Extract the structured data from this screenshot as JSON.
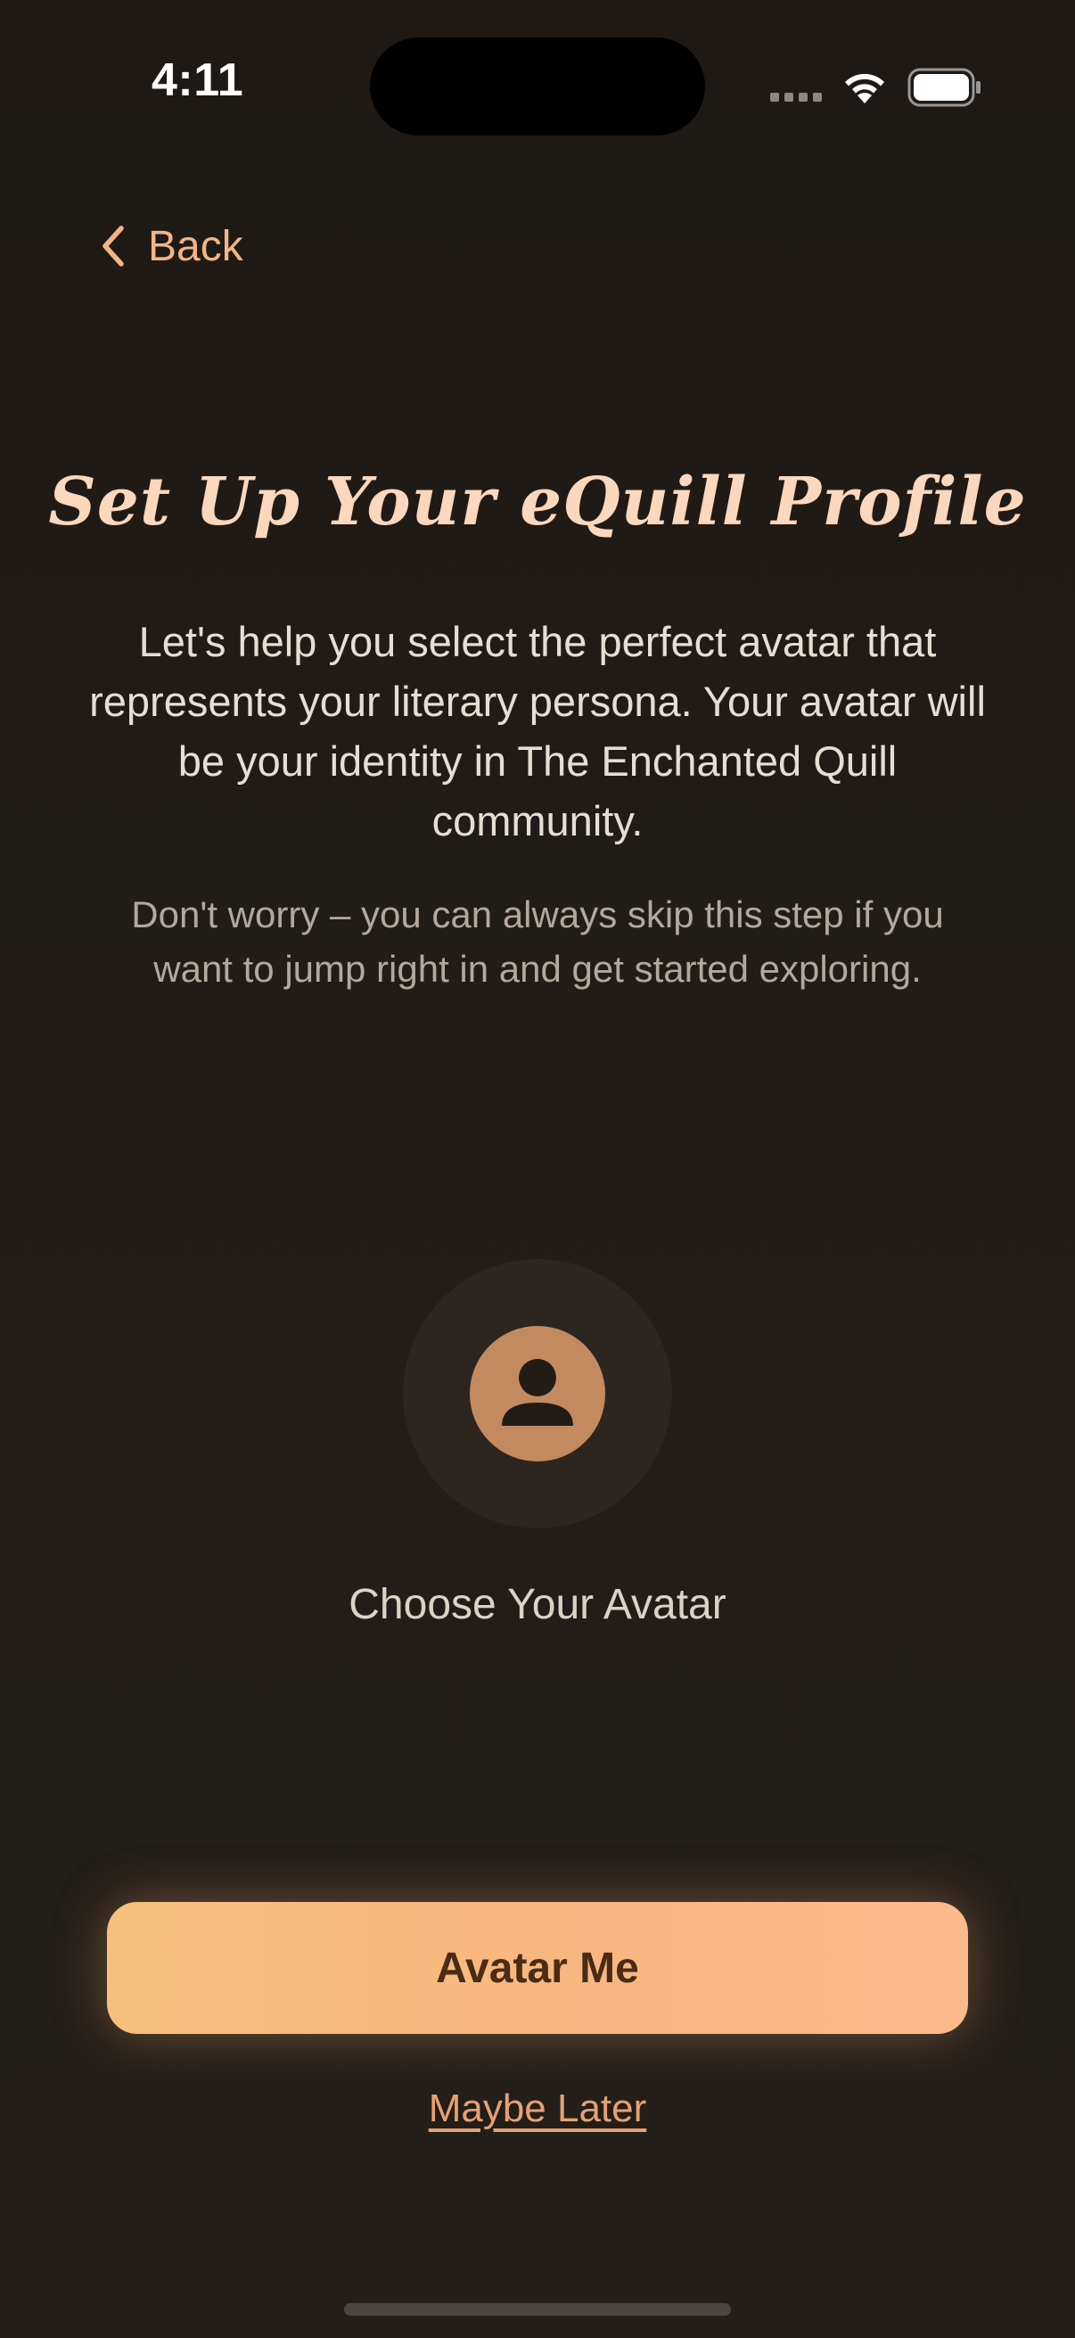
{
  "status_bar": {
    "time": "4:11",
    "icons": [
      "cellular-signal-icon",
      "wifi-icon",
      "battery-icon"
    ]
  },
  "nav": {
    "back_label": "Back",
    "back_icon": "chevron-left-icon"
  },
  "header": {
    "title": "Set Up Your eQuill Profile"
  },
  "body": {
    "intro": "Let's help you select the perfect avatar that represents your literary persona. Your avatar will be your identity in The Enchanted Quill community.",
    "skip_note": "Don't worry – you can always skip this step if you want to jump right in and get started exploring."
  },
  "avatar": {
    "icon": "person-placeholder-icon",
    "caption": "Choose Your Avatar"
  },
  "actions": {
    "primary_label": "Avatar Me",
    "secondary_label": "Maybe Later"
  },
  "colors": {
    "background": "#211c18",
    "accent": "#f3b586",
    "title": "#fbd7bd",
    "button_start": "#f5c07c",
    "button_end": "#fcb98d",
    "avatar_icon": "#c48a5f"
  }
}
